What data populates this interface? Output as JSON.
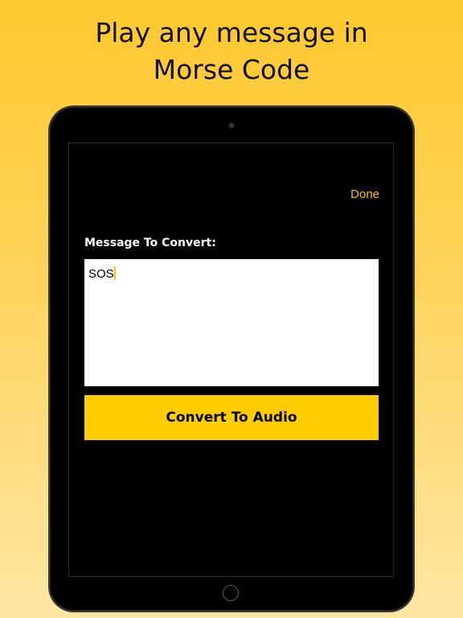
{
  "headline": {
    "line1": "Play any message in",
    "line2": "Morse Code"
  },
  "nav": {
    "done_label": "Done"
  },
  "form": {
    "message_label": "Message To Convert:",
    "message_value": "SOS",
    "convert_label": "Convert To Audio"
  },
  "colors": {
    "accent": "#ffcc00",
    "done_link": "#ffc200",
    "background_top": "#ffc82e",
    "background_bottom": "#ffe6a3",
    "screen": "#000000"
  },
  "icons": {
    "camera": "camera-icon",
    "home": "home-button-icon"
  }
}
